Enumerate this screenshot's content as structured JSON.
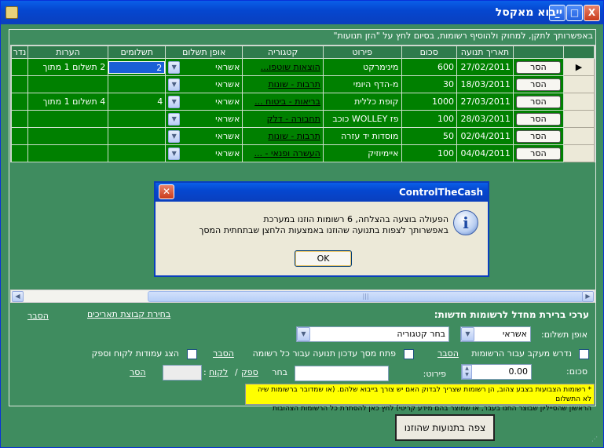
{
  "window": {
    "title": "ייבוא מאקסל",
    "minimize": "_",
    "maximize": "□",
    "close": "X"
  },
  "hint": "באפשרותך לתקן, למחוק ולהוסיף רשומות, בסיום לחץ על \"הזן תנועות\"",
  "grid": {
    "columns": [
      "",
      "",
      "תאריך תנועה",
      "סכום",
      "פירוט",
      "קטגוריה",
      "אופן תשלום",
      "תשלומים",
      "הערות",
      "נדר"
    ],
    "delete_label": "הסר",
    "rows": [
      {
        "marker": "▶",
        "date": "27/02/2011",
        "amount": "600",
        "detail": "מינימרקט",
        "category": "הוצאות שוטפו...",
        "payment": "אשראי",
        "installments": "2",
        "notes": "2 תשלום 1 מתוך"
      },
      {
        "marker": "",
        "date": "18/03/2011",
        "amount": "30",
        "detail": "מ-הדף היומי",
        "category": "תרבות - שונות",
        "payment": "אשראי",
        "installments": "",
        "notes": ""
      },
      {
        "marker": "",
        "date": "27/03/2011",
        "amount": "1000",
        "detail": "קופת כללית",
        "category": "בריאות - ביטוח ...",
        "payment": "אשראי",
        "installments": "4",
        "notes": "4 תשלום 1 מתוך"
      },
      {
        "marker": "",
        "date": "28/03/2011",
        "amount": "100",
        "detail": "פז WOLLEY כוכב",
        "category": "תחבורה - דלק",
        "payment": "אשראי",
        "installments": "",
        "notes": ""
      },
      {
        "marker": "",
        "date": "02/04/2011",
        "amount": "50",
        "detail": "מוסדות יד עזרה",
        "category": "תרבות - שונות",
        "payment": "אשראי",
        "installments": "",
        "notes": ""
      },
      {
        "marker": "",
        "date": "04/04/2011",
        "amount": "100",
        "detail": "איימיוזיק",
        "category": "העשרה ופנאי - ...",
        "payment": "אשראי",
        "installments": "",
        "notes": ""
      }
    ]
  },
  "dialog": {
    "title": "ControlTheCash",
    "line1": "הפעולה בוצעה בהצלחה, 6 רשומות הוזנו במערכת",
    "line2": "באפשרותך לצפות בתנועה שהוזנו באמצעות הלחצן שבתחתית המסך",
    "ok": "OK"
  },
  "defaults": {
    "section_title": "ערכי ברירת מחדל לרשומות חדשות:",
    "date_group_link": "בחירת קבוצת תאריכים",
    "explain_link": "הסבר",
    "payment_label": "אופן תשלום:",
    "payment_value": "אשראי",
    "category_value": "בחר קטגוריה",
    "track_label": "נדרש מעקב עבור הרשומות",
    "track_explain": "הסבר",
    "open_update_label": "פתח מסך עדכון תנועה עבור כל רשומה",
    "open_update_explain": "הסבר",
    "show_columns_label": "הצג עמודות לקוח וספק",
    "amount_label": "סכום:",
    "amount_value": "0.00",
    "detail_label": "פירוט:",
    "choose_label": "בחר",
    "supplier_link": "ספק",
    "customer_link": "לקוח",
    "remove_link": "הסר",
    "warning_line1": "* רשומות הצבועות בצבע צהוב, הן רשומות שצריך לבדוק האם יש צורך בייבוא שלהם. (או שמדובר ברשומות שיה לא התשלום",
    "warning_line2": "הראשון שהסייליון שבוצר החנו בעבר, או שמוצר בהם מידע קריטי) לחץ כאן להסתרת כל הרשומות הצהובות"
  },
  "view_button": "צפה בתנועות שהוזנו"
}
